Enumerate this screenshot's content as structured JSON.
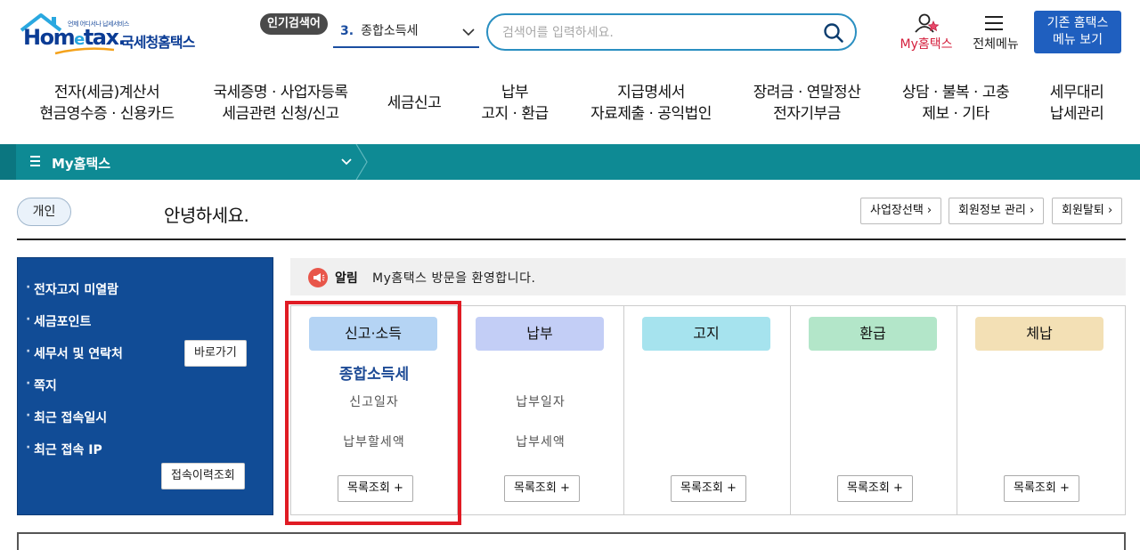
{
  "header": {
    "logo_tagline": "언제 어디서나 납세서비스",
    "logo_main_a": "Hom",
    "logo_main_e": "e",
    "logo_main_b": "tax.",
    "logo_sub": "국세청홈택스",
    "popular_label": "인기검색어",
    "popular_rank": "3.",
    "popular_term": "종합소득세",
    "search_placeholder": "검색어를 입력하세요.",
    "my_hometax": "My홈택스",
    "all_menu": "전체메뉴",
    "legacy_line1": "기존 홈택스",
    "legacy_line2": "메뉴 보기"
  },
  "gnb": [
    {
      "line1": "전자(세금)계산서",
      "line2": "현금영수증 · 신용카드"
    },
    {
      "line1": "국세증명 · 사업자등록",
      "line2": "세금관련 신청/신고"
    },
    {
      "line1": "세금신고",
      "line2": ""
    },
    {
      "line1": "납부",
      "line2": "고지 · 환급"
    },
    {
      "line1": "지급명세서",
      "line2": "자료제출 · 공익법인"
    },
    {
      "line1": "장려금 · 연말정산",
      "line2": "전자기부금"
    },
    {
      "line1": "상담 · 불복 · 고충",
      "line2": "제보 · 기타"
    },
    {
      "line1": "세무대리",
      "line2": "납세관리"
    }
  ],
  "mybar": {
    "title": "My홈택스"
  },
  "user": {
    "type": "개인",
    "greeting": "안녕하세요.",
    "buttons": [
      "사업장선택 ›",
      "회원정보 관리 ›",
      "회원탈퇴 ›"
    ]
  },
  "side": {
    "items": [
      "전자고지 미열람",
      "세금포인트",
      "세무서 및 연락처",
      "쪽지",
      "최근 접속일시",
      "최근 접속 IP"
    ],
    "goto_btn": "바로가기",
    "history_btn": "접속이력조회"
  },
  "notice": {
    "label": "알림",
    "text": "My홈택스 방문을 환영합니다."
  },
  "cards": [
    {
      "title": "신고·소득",
      "main": "종합소득세",
      "line1": "신고일자",
      "line2": "납부할세액",
      "btn": "목록조회 +",
      "color": "#b5d4f4"
    },
    {
      "title": "납부",
      "main": "",
      "line1": "납부일자",
      "line2": "납부세액",
      "btn": "목록조회 +",
      "color": "#c3cef6"
    },
    {
      "title": "고지",
      "main": "",
      "line1": "",
      "line2": "",
      "btn": "목록조회 +",
      "color": "#a6e3ee"
    },
    {
      "title": "환급",
      "main": "",
      "line1": "",
      "line2": "",
      "btn": "목록조회 +",
      "color": "#b3e6c9"
    },
    {
      "title": "체납",
      "main": "",
      "line1": "",
      "line2": "",
      "btn": "목록조회 +",
      "color": "#f3e0b5"
    }
  ],
  "colors": {
    "teal_bar": "#0e8a94",
    "side_panel": "#114c96",
    "highlight": "#e01b24",
    "brand_blue": "#1f5fbf"
  }
}
